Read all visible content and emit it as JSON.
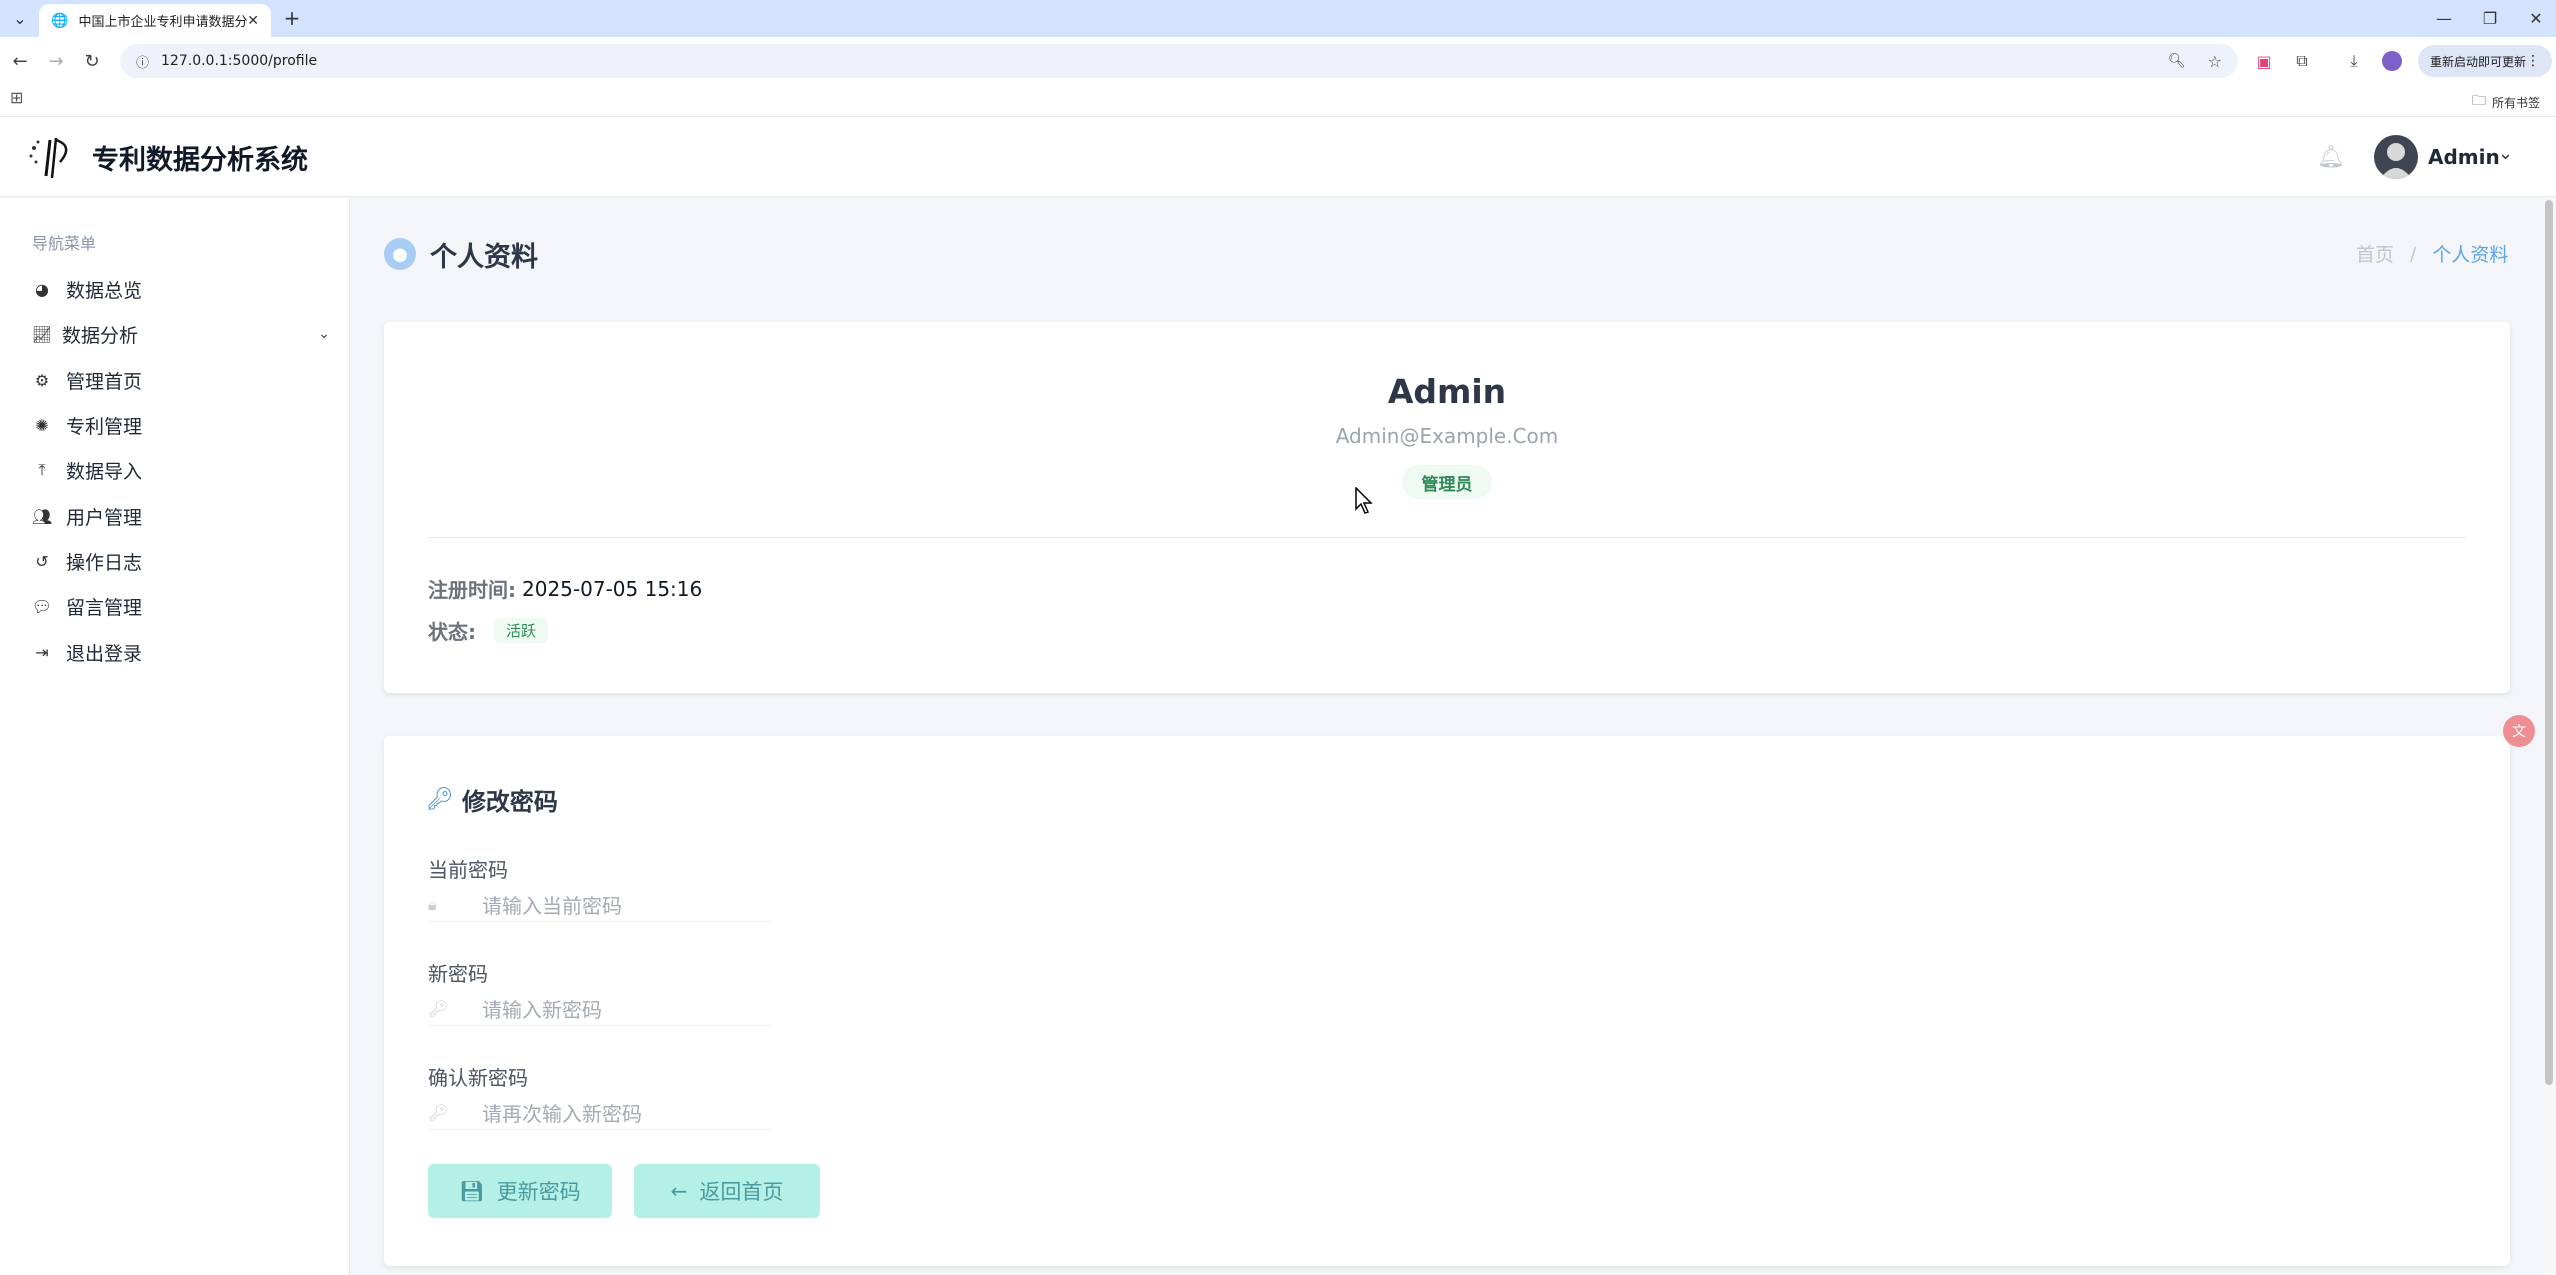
{
  "browser": {
    "tab_title": "中国上市企业专利申请数据分析",
    "url": "127.0.0.1:5000/profile",
    "update_label": "重新启动即可更新",
    "bookmarks_all": "所有书签"
  },
  "app": {
    "title": "专利数据分析系统",
    "user_name": "Admin"
  },
  "sidebar": {
    "heading": "导航菜单",
    "items": [
      {
        "label": "数据总览",
        "icon": "chart-pie-icon"
      },
      {
        "label": "数据分析",
        "icon": "chart-line-icon"
      },
      {
        "label": "管理首页",
        "icon": "cogs-icon"
      },
      {
        "label": "专利管理",
        "icon": "lightbulb-icon"
      },
      {
        "label": "数据导入",
        "icon": "upload-icon"
      },
      {
        "label": "用户管理",
        "icon": "users-icon"
      },
      {
        "label": "操作日志",
        "icon": "history-icon"
      },
      {
        "label": "留言管理",
        "icon": "comments-icon"
      },
      {
        "label": "退出登录",
        "icon": "sign-out-icon"
      }
    ]
  },
  "page": {
    "title": "个人资料",
    "breadcrumb": {
      "home": "首页",
      "separator": "/",
      "current": "个人资料"
    }
  },
  "profile": {
    "name": "Admin",
    "email": "Admin@Example.Com",
    "role": "管理员",
    "reg_label": "注册时间:",
    "reg_value": "2025-07-05 15:16",
    "status_label": "状态:",
    "status_value": "活跃"
  },
  "password": {
    "title": "修改密码",
    "current_label": "当前密码",
    "current_placeholder": "请输入当前密码",
    "new_label": "新密码",
    "new_placeholder": "请输入新密码",
    "confirm_label": "确认新密码",
    "confirm_placeholder": "请再次输入新密码",
    "update_button": "更新密码",
    "back_button": "返回首页"
  },
  "colors": {
    "accent": "#5aa6e8",
    "button_bg": "#b4f0e6",
    "badge_green": "#2e8b57"
  }
}
